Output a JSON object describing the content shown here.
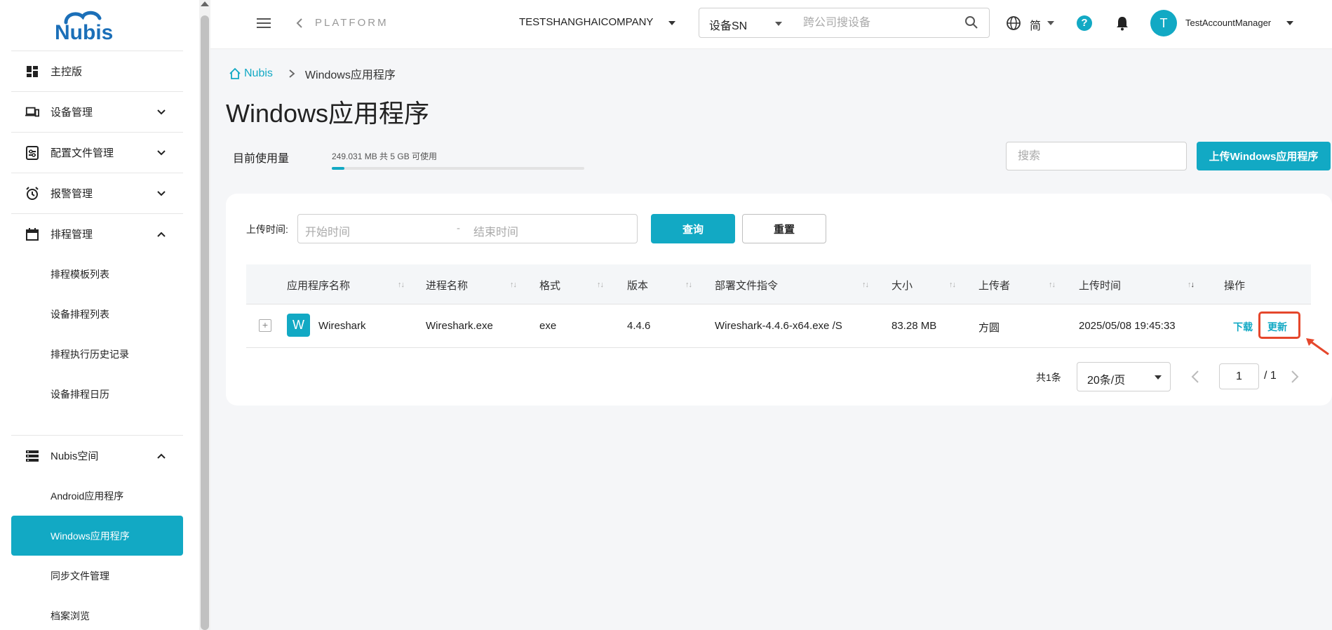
{
  "logo_text": "Nubis",
  "sidebar": {
    "items": [
      {
        "label": "主控版",
        "icon": "dashboard-icon"
      },
      {
        "label": "设备管理",
        "icon": "devices-icon"
      },
      {
        "label": "配置文件管理",
        "icon": "config-file-icon"
      },
      {
        "label": "报警管理",
        "icon": "alarm-clock-icon"
      },
      {
        "label": "排程管理",
        "icon": "calendar-icon"
      }
    ],
    "schedule_sub": [
      "排程模板列表",
      "设备排程列表",
      "排程执行历史记录",
      "设备排程日历"
    ],
    "space": {
      "label": "Nubis空间",
      "icon": "storage-icon"
    },
    "space_sub": [
      "Android应用程序",
      "Windows应用程序",
      "同步文件管理",
      "档案浏览"
    ]
  },
  "header": {
    "back_label": "PLATFORM",
    "company": "TESTSHANGHAICOMPANY",
    "search_type": "设备SN",
    "search_placeholder": "跨公司搜设备",
    "language": "简",
    "help": "?",
    "avatar_initial": "T",
    "user_name": "TestAccountManager"
  },
  "breadcrumb": {
    "home": "Nubis",
    "current": "Windows应用程序"
  },
  "page_title": "Windows应用程序",
  "usage": {
    "label": "目前使用量",
    "text": "249.031 MB 共 5 GB 可使用",
    "fraction": 0.049
  },
  "search_placeholder": "搜索",
  "upload_button": "上传Windows应用程序",
  "filter": {
    "label": "上传时间:",
    "start_placeholder": "开始时间",
    "separator": "-",
    "end_placeholder": "结束时间",
    "query_button": "查询",
    "reset_button": "重置"
  },
  "table": {
    "columns": [
      "应用程序名称",
      "进程名称",
      "格式",
      "版本",
      "部署文件指令",
      "大小",
      "上传者",
      "上传时间",
      "操作"
    ],
    "rows": [
      {
        "icon_letter": "W",
        "expand": "+",
        "name": "Wireshark",
        "process": "Wireshark.exe",
        "format": "exe",
        "version": "4.4.6",
        "command": "Wireshark-4.4.6-x64.exe /S",
        "size": "83.28 MB",
        "uploader": "方圆",
        "upload_time": "2025/05/08 19:45:33",
        "actions": [
          "下载",
          "更新"
        ]
      }
    ]
  },
  "pagination": {
    "total": "共1条",
    "page_size": "20条/页",
    "current_page": "1",
    "total_pages": "/ 1"
  },
  "colors": {
    "accent": "#12a9c4",
    "highlight": "#e5472c"
  }
}
